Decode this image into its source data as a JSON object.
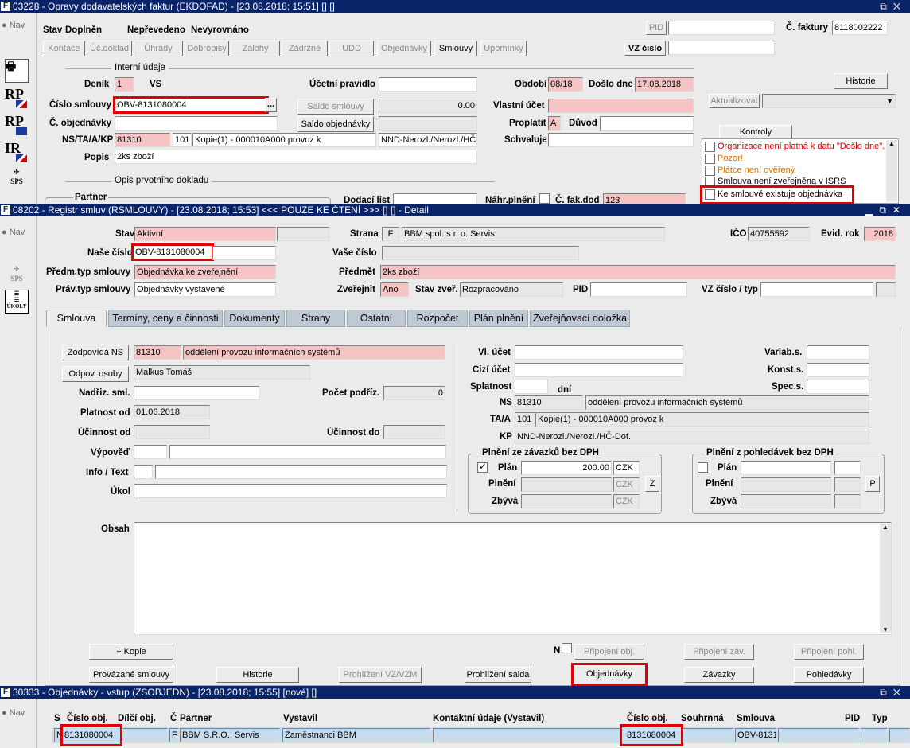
{
  "win1": {
    "title": "03228 - Opravy dodavatelských faktur (EKDOFAD) - [23.08.2018; 15:51] [] []"
  },
  "win2": {
    "title": "08202 - Registr smluv (RSMLOUVY) - [23.08.2018; 15:53] <<< POUZE KE ČTENÍ >>> [] [] - Detail"
  },
  "win3": {
    "title": "30333 - Objednávky - vstup (ZSOBJEDN) - [23.08.2018; 15:55] [nové] []"
  },
  "nav": "Nav",
  "side": {
    "rp": "RP",
    "ir": "IR",
    "sps": "SPS",
    "ukoly": "ÚKOLY"
  },
  "inv": {
    "stav_l": "Stav",
    "stav1": "Doplněn",
    "stav2": "Nepřevedeno",
    "stav3": "Nevyrovnáno",
    "tabs": [
      "Kontace",
      "Úč.doklad",
      "Úhrady",
      "Dobropisy",
      "Zálohy",
      "Zádržné",
      "UDD",
      "Objednávky",
      "Smlouvy",
      "Upomínky"
    ],
    "pid_btn": "PID",
    "cfakt_l": "Č. faktury",
    "cfakt": "8118002222",
    "vz_l": "VZ číslo",
    "interni": "Interní údaje",
    "denik_l": "Deník",
    "denik": "1",
    "vs_l": "VS",
    "ucpr_l": "Účetní pravidlo",
    "obdobi_l": "Období",
    "obdobi": "08/18",
    "doslo_l": "Došlo dne",
    "doslo": "17.08.2018",
    "historie": "Historie",
    "cs_l": "Číslo smlouvy",
    "cs": "OBV-8131080004",
    "dots": "...",
    "saldo_s": "Saldo smlouvy",
    "saldo_s_val": "0.00",
    "vlastni_l": "Vlastní účet",
    "aktualizovat": "Aktualizovat",
    "cobj_l": "Č. objednávky",
    "saldo_o": "Saldo objednávky",
    "proplatit_l": "Proplatit",
    "proplatit": "A",
    "duvod_l": "Důvod",
    "ns_l": "NS/TA/A/KP",
    "ns": "81310",
    "ta": "101",
    "kopie": "Kopie(1) - 000010A000 provoz k",
    "nnd": "NND-Nerozl./Nerozl./HČ-D",
    "schval_l": "Schvaluje",
    "popis_l": "Popis",
    "popis": "2ks zboží",
    "opis": "Opis prvotního dokladu",
    "partner": "Partner",
    "dodaci_l": "Dodací list",
    "nahr_l": "Náhr.plnění",
    "cfakdod_l": "Č. fak.dod",
    "cfakdod": "123",
    "kontroly": "Kontroly",
    "checks": [
      "Organizace není platná k datu \"Došlo dne\".",
      "Pozor!",
      "Plátce není ověřený",
      "Smlouva není zveřejněna v ISRS",
      "Ke smlouvě existuje objednávka"
    ]
  },
  "reg": {
    "stav_l": "Stav",
    "stav": "Aktivní",
    "strana_l": "Strana",
    "strana": "F",
    "strana_n": "BBM spol. s r. o. Servis",
    "ico_l": "IČO",
    "ico": "40755592",
    "evid_l": "Evid. rok",
    "evid": "2018",
    "nase_l": "Naše číslo",
    "nase": "OBV-8131080004",
    "vase_l": "Vaše číslo",
    "predmtyp_l": "Předm.typ smlouvy",
    "predmtyp": "Objednávka ke zveřejnění",
    "predmet_l": "Předmět",
    "predmet": "2ks zboží",
    "pravtyp_l": "Práv.typ smlouvy",
    "pravtyp": "Objednávky vystavené",
    "zverejnit_l": "Zveřejnit",
    "zverejnit": "Ano",
    "stavzver_l": "Stav zveř.",
    "stavzver": "Rozpracováno",
    "pid_l": "PID",
    "vz_l": "VZ číslo / typ",
    "tabs": [
      "Smlouva",
      "Termíny, ceny a činnosti",
      "Dokumenty",
      "Strany",
      "Ostatní",
      "Rozpočet",
      "Plán plnění",
      "Zveřejňovací doložka"
    ],
    "zodp_btn": "Zodpovídá NS",
    "zodp_ns": "81310",
    "zodp_n": "oddělení provozu informačních systémů",
    "odpov_btn": "Odpov. osoby",
    "odpov": "Malkus Tomáš",
    "nadriz_l": "Nadřiz. sml.",
    "pocet_l": "Počet podříz.",
    "pocet": "0",
    "platnost_l": "Platnost od",
    "platnost": "01.06.2018",
    "ucinnost_l": "Účinnost od",
    "ucinnost_do_l": "Účinnost do",
    "vypoved_l": "Výpověď",
    "info_l": "Info / Text",
    "ukol_l": "Úkol",
    "vlucet_l": "Vl. účet",
    "cizi_l": "Cizí účet",
    "splat_l": "Splatnost",
    "dni": "dní",
    "ns_l": "NS",
    "ns": "81310",
    "ns_n": "oddělení provozu informačních systémů",
    "ta_l": "TA/A",
    "ta": "101",
    "ta_n": "Kopie(1) - 000010A000 provoz k",
    "kp_l": "KP",
    "kp": "NND-Nerozl./Nerozl./HČ-Dot.",
    "variab_l": "Variab.s.",
    "konst_l": "Konst.s.",
    "spec_l": "Spec.s.",
    "plz_title": "Plnění ze závazků bez DPH",
    "plan_l": "Plán",
    "plan": "200.00",
    "czk": "CZK",
    "plneni_l": "Plnění",
    "zbyva_l": "Zbývá",
    "z_btn": "Z",
    "plp_title": "Plnění z pohledávek bez DPH",
    "p_btn": "P",
    "obsah_l": "Obsah",
    "kopie_btn": "+ Kopie",
    "n_l": "N",
    "pripobj": "Připojení obj.",
    "pripzav": "Připojení záv.",
    "pripohl": "Připojení pohl.",
    "provaz": "Provázané smlouvy",
    "historie": "Historie",
    "prohlvz": "Prohlížení VZ/VZM",
    "prohlsal": "Prohlížení salda",
    "objednavky": "Objednávky",
    "zavazky": "Závazky",
    "pohledavky": "Pohledávky"
  },
  "obj": {
    "cols": [
      "S",
      "Číslo obj.",
      "Dílčí obj.",
      "Č",
      "Partner",
      "Vystavil",
      "Kontaktní údaje (Vystavil)",
      "Číslo obj.",
      "Souhrnná",
      "Smlouva",
      "PID",
      "Typ"
    ],
    "row": {
      "s": "N",
      "cislo": "8131080004",
      "c": "F",
      "partner": "BBM S.R.O.. Servis",
      "vystavil": "Zaměstnanci BBM",
      "cislo2": "8131080004",
      "smlouva": "OBV-8131"
    }
  }
}
